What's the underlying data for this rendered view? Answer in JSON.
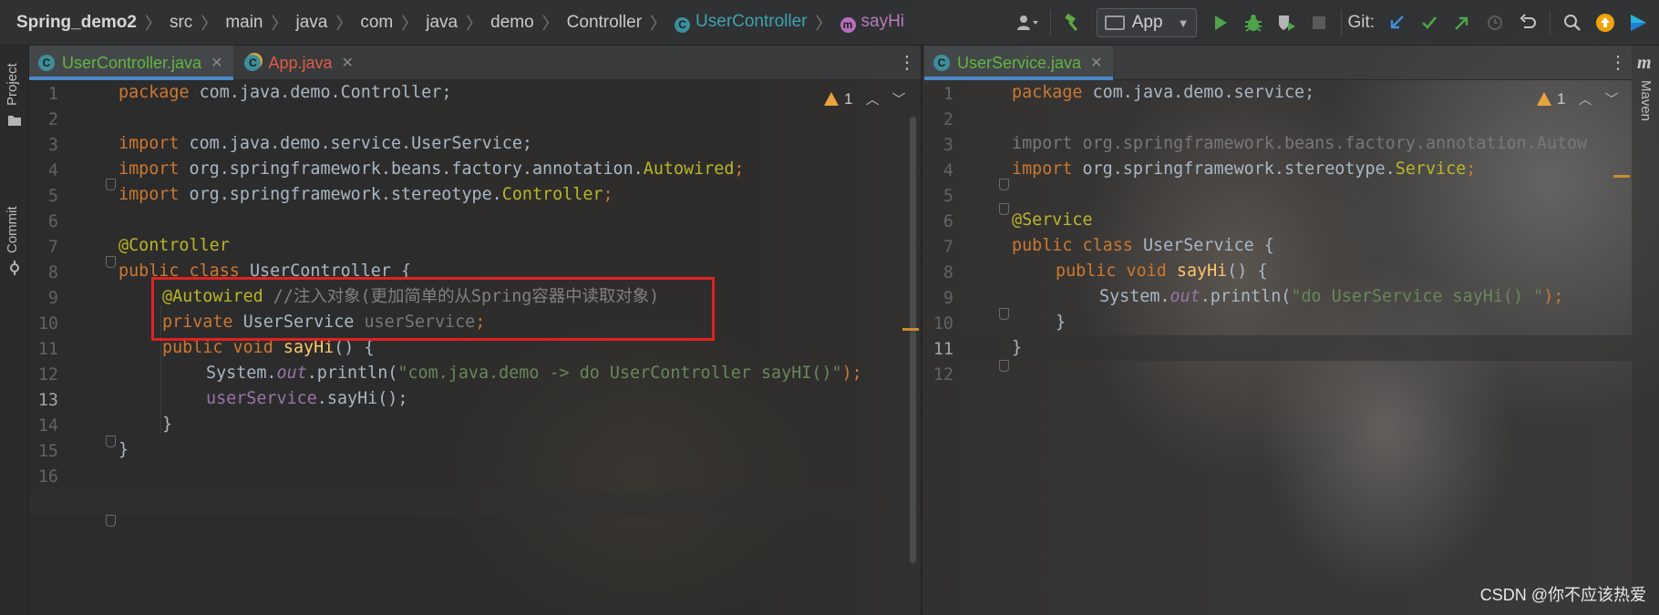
{
  "breadcrumbs": {
    "project": "Spring_demo2",
    "items": [
      "src",
      "main",
      "java",
      "com",
      "java",
      "demo",
      "Controller"
    ],
    "class": "UserController",
    "class_icon": "C",
    "method": "sayHi",
    "method_icon": "m"
  },
  "toolbar": {
    "run_config": "App",
    "git_label": "Git:"
  },
  "left_strip": {
    "project_tab": "Project",
    "commit_tab": "Commit"
  },
  "right_strip": {
    "maven_tab": "Maven",
    "maven_logo": "m"
  },
  "left_pane": {
    "tabs": [
      {
        "label": "UserController.java",
        "icon": "C",
        "active": true
      },
      {
        "label": "App.java",
        "icon": "C",
        "active": false
      }
    ],
    "warnings": "1",
    "line_numbers": [
      "1",
      "2",
      "3",
      "4",
      "5",
      "6",
      "7",
      "8",
      "9",
      "10",
      "11",
      "12",
      "13",
      "14",
      "15",
      "16"
    ],
    "current_line": "13"
  },
  "right_pane": {
    "tabs": [
      {
        "label": "UserService.java",
        "icon": "C",
        "active": true
      }
    ],
    "warnings": "1",
    "line_numbers": [
      "1",
      "2",
      "3",
      "4",
      "5",
      "6",
      "7",
      "8",
      "9",
      "10",
      "11",
      "12"
    ],
    "current_line": "11"
  },
  "code_left": {
    "l1": [
      "package",
      " com.java.demo.Controller;"
    ],
    "l3": [
      "import",
      " com.java.demo.service.UserService;"
    ],
    "l4": [
      "import",
      " org.springframework.beans.factory.annotation.",
      "Autowired",
      ";"
    ],
    "l5": [
      "import",
      " org.springframework.stereotype.",
      "Controller",
      ";"
    ],
    "l7": "@Controller",
    "l8": [
      "public class",
      " UserController {"
    ],
    "l9": [
      "@Autowired",
      " //注入对象(更加简单的从Spring容器中读取对象)"
    ],
    "l10": [
      "private",
      " UserService ",
      "userService",
      ";"
    ],
    "l11": [
      "public void",
      " sayHi",
      "() {"
    ],
    "l12": [
      "System.",
      "out",
      ".println(",
      "\"com.java.demo -> do UserController sayHI()\"",
      ");"
    ],
    "l13": [
      "userService",
      ".sayHi();"
    ],
    "l14": "}",
    "l15": "}"
  },
  "code_right": {
    "l1": [
      "package",
      " com.java.demo.service;"
    ],
    "l3": [
      "import",
      " org.springframework.beans.factory.annotation.Autow"
    ],
    "l4": [
      "import",
      " org.springframework.stereotype.",
      "Service",
      ";"
    ],
    "l6": "@Service",
    "l7": [
      "public class",
      " UserService {"
    ],
    "l8": [
      "public void",
      " sayHi",
      "() {"
    ],
    "l9": [
      "System.",
      "out",
      ".println(",
      "\"do UserService sayHi() \"",
      ");"
    ],
    "l10": "}",
    "l11": "}"
  },
  "watermark": "CSDN @你不应该热爱",
  "colors": {
    "keyword": "#cc7832",
    "annotation": "#bbb529",
    "string": "#6a8759",
    "comment": "#808080",
    "method": "#ffc66d",
    "field": "#9876aa",
    "highlight_box": "#e02222",
    "active_tab_underline": "#4a88c7"
  }
}
